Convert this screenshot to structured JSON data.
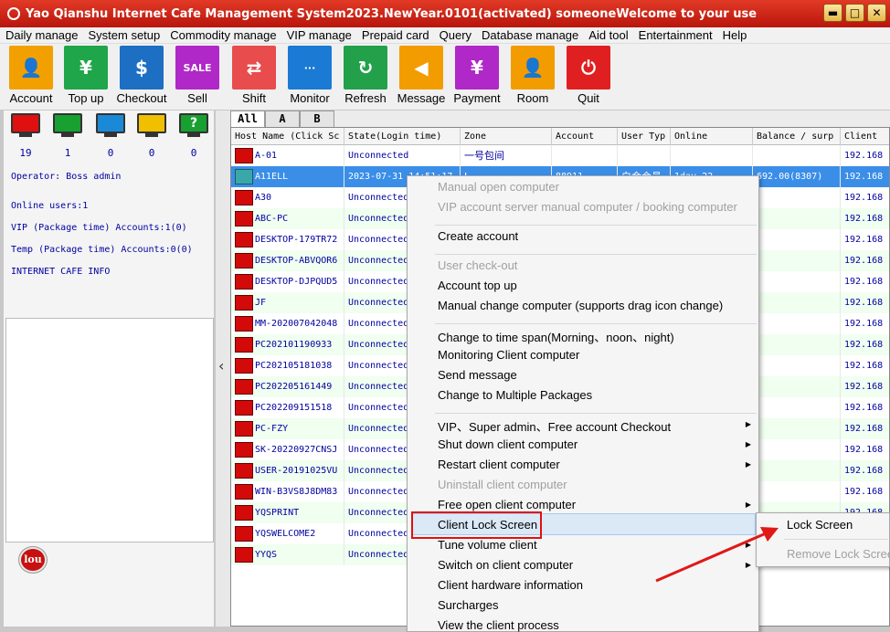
{
  "window": {
    "title": "Yao Qianshu Internet Cafe Management System2023.NewYear.0101(activated)  someoneWelcome to your use",
    "buttons": [
      "▬",
      "□",
      "✕"
    ]
  },
  "menu": [
    "Daily manage",
    "System setup",
    "Commodity manage",
    "VIP manage",
    "Prepaid card",
    "Query",
    "Database manage",
    "Aid tool",
    "Entertainment",
    "Help"
  ],
  "toolbar": [
    {
      "label": "Account",
      "color": "#f2a000",
      "icon": "person-icon",
      "glyph": "👤"
    },
    {
      "label": "Top up",
      "color": "#1fa54a",
      "icon": "money-bag-icon",
      "glyph": "¥"
    },
    {
      "label": "Checkout",
      "color": "#1d6fc4",
      "icon": "checkout-icon",
      "glyph": "$"
    },
    {
      "label": "Sell",
      "color": "#b028c8",
      "icon": "sale-tag-icon",
      "glyph": "SALE"
    },
    {
      "label": "Shift",
      "color": "#e84c4c",
      "icon": "shift-icon",
      "glyph": "⇄"
    },
    {
      "label": "Monitor",
      "color": "#1a7ad4",
      "icon": "monitor-icon",
      "glyph": "···"
    },
    {
      "label": "Refresh",
      "color": "#22a04a",
      "icon": "refresh-icon",
      "glyph": "↻"
    },
    {
      "label": "Message",
      "color": "#f29c00",
      "icon": "speaker-icon",
      "glyph": "◀"
    },
    {
      "label": "Payment",
      "color": "#b028c8",
      "icon": "payment-icon",
      "glyph": "¥"
    },
    {
      "label": "Room",
      "color": "#f29c00",
      "icon": "room-icon",
      "glyph": "👤"
    },
    {
      "label": "Quit",
      "color": "#e02020",
      "icon": "power-icon",
      "glyph": "⏻"
    }
  ],
  "status_monitors": [
    {
      "color": "#e01010",
      "count": "19"
    },
    {
      "color": "#18a030",
      "count": "1"
    },
    {
      "color": "#1a8ad8",
      "count": "0"
    },
    {
      "color": "#f0c000",
      "count": "0"
    },
    {
      "color": "#18a030",
      "count": "0",
      "glyph": "?"
    }
  ],
  "left_info": {
    "operator": "Operator: Boss admin",
    "online_users": "Online users:1",
    "vip_accounts": "VIP (Package time) Accounts:1(0)",
    "temp_accounts": "Temp (Package time) Accounts:0(0)",
    "cafe_info": "INTERNET CAFE  INFO"
  },
  "logo_text": "lou",
  "tabs": [
    "All",
    "A",
    "B"
  ],
  "columns": [
    "Host Name (Click Sc",
    "State(Login time)",
    "Zone",
    "Account",
    "User Typ",
    "Online",
    "Balance / surp",
    "Client"
  ],
  "rows": [
    {
      "host": "A-01",
      "state": "Unconnected",
      "zone": "一号包间",
      "account": "",
      "utype": "",
      "online": "",
      "balance": "",
      "client": "192.168"
    },
    {
      "host": "A11ELL",
      "state": "2023-07-31 14:51:17",
      "zone": "L",
      "account": "88911",
      "utype": "白金会员",
      "online": "1day 22",
      "balance": "692.00(8307)",
      "client": "192.168"
    },
    {
      "host": "A30",
      "state": "Unconnected",
      "zone": "",
      "account": "",
      "utype": "",
      "online": "",
      "balance": "",
      "client": "192.168"
    },
    {
      "host": "ABC-PC",
      "state": "Unconnected",
      "zone": "",
      "account": "",
      "utype": "",
      "online": "",
      "balance": "",
      "client": "192.168"
    },
    {
      "host": "DESKTOP-179TR72",
      "state": "Unconnected",
      "zone": "",
      "account": "",
      "utype": "",
      "online": "",
      "balance": "",
      "client": "192.168"
    },
    {
      "host": "DESKTOP-ABVQOR6",
      "state": "Unconnected",
      "zone": "",
      "account": "",
      "utype": "",
      "online": "",
      "balance": "",
      "client": "192.168"
    },
    {
      "host": "DESKTOP-DJPQUD5",
      "state": "Unconnected",
      "zone": "",
      "account": "",
      "utype": "",
      "online": "",
      "balance": "",
      "client": "192.168"
    },
    {
      "host": "JF",
      "state": "Unconnected",
      "zone": "",
      "account": "",
      "utype": "",
      "online": "",
      "balance": "",
      "client": "192.168"
    },
    {
      "host": "MM-202007042048",
      "state": "Unconnected",
      "zone": "",
      "account": "",
      "utype": "",
      "online": "",
      "balance": "",
      "client": "192.168"
    },
    {
      "host": "PC202101190933",
      "state": "Unconnected",
      "zone": "",
      "account": "",
      "utype": "",
      "online": "",
      "balance": "",
      "client": "192.168"
    },
    {
      "host": "PC202105181038",
      "state": "Unconnected",
      "zone": "",
      "account": "",
      "utype": "",
      "online": "",
      "balance": "",
      "client": "192.168"
    },
    {
      "host": "PC202205161449",
      "state": "Unconnected",
      "zone": "",
      "account": "",
      "utype": "",
      "online": "",
      "balance": "",
      "client": "192.168"
    },
    {
      "host": "PC202209151518",
      "state": "Unconnected",
      "zone": "",
      "account": "",
      "utype": "",
      "online": "",
      "balance": "",
      "client": "192.168"
    },
    {
      "host": "PC-FZY",
      "state": "Unconnected",
      "zone": "",
      "account": "",
      "utype": "",
      "online": "",
      "balance": "",
      "client": "192.168"
    },
    {
      "host": "SK-20220927CNSJ",
      "state": "Unconnected",
      "zone": "",
      "account": "",
      "utype": "",
      "online": "",
      "balance": "",
      "client": "192.168"
    },
    {
      "host": "USER-20191025VU",
      "state": "Unconnected",
      "zone": "",
      "account": "",
      "utype": "",
      "online": "",
      "balance": "",
      "client": "192.168"
    },
    {
      "host": "WIN-B3VS8J8DM83",
      "state": "Unconnected",
      "zone": "",
      "account": "",
      "utype": "",
      "online": "",
      "balance": "",
      "client": "192.168"
    },
    {
      "host": "YQSPRINT",
      "state": "Unconnected",
      "zone": "",
      "account": "",
      "utype": "",
      "online": "",
      "balance": "",
      "client": "192.168"
    },
    {
      "host": "YQSWELCOME2",
      "state": "Unconnected",
      "zone": "",
      "account": "",
      "utype": "",
      "online": "",
      "balance": "",
      "client": "192.168"
    },
    {
      "host": "YYQS",
      "state": "Unconnected",
      "zone": "",
      "account": "",
      "utype": "",
      "online": "",
      "balance": "",
      "client": "192.168"
    }
  ],
  "context_menu": [
    {
      "label": "Manual open computer",
      "disabled": true
    },
    {
      "label": "VIP account server manual computer / booking computer",
      "disabled": true
    },
    {
      "sep": true
    },
    {
      "label": "Create account",
      "disabled": false
    },
    {
      "sep": true
    },
    {
      "label": "User check-out",
      "disabled": true
    },
    {
      "label": "Account top up",
      "disabled": false
    },
    {
      "label": "Manual change computer (supports drag icon change)",
      "disabled": false
    },
    {
      "sep": true
    },
    {
      "label": "Change to time span(Morning、noon、night)",
      "disabled": false
    },
    {
      "label": "Monitoring Client computer",
      "disabled": false
    },
    {
      "label": "Send message",
      "disabled": false
    },
    {
      "label": "Change to Multiple Packages",
      "disabled": false
    },
    {
      "sep": true
    },
    {
      "label": "VIP、Super admin、Free account Checkout",
      "disabled": false,
      "sub": true
    },
    {
      "label": "Shut down client computer",
      "disabled": false,
      "sub": true
    },
    {
      "label": "Restart client computer",
      "disabled": false,
      "sub": true
    },
    {
      "label": "Uninstall client computer",
      "disabled": true
    },
    {
      "label": "Free open client computer",
      "disabled": false,
      "sub": true
    },
    {
      "label": "Client Lock Screen",
      "disabled": false,
      "sub": true,
      "highlighted": true
    },
    {
      "label": "Tune  volume client",
      "disabled": false,
      "sub": true
    },
    {
      "label": "Switch on client computer",
      "disabled": false,
      "sub": true
    },
    {
      "label": "Client hardware information",
      "disabled": false
    },
    {
      "label": "Surcharges",
      "disabled": false
    },
    {
      "label": "View the client process",
      "disabled": false
    }
  ],
  "submenu": [
    {
      "label": "Lock Screen",
      "disabled": false
    },
    {
      "label": "Remove Lock Screen",
      "disabled": true
    }
  ],
  "collapse_glyph": "‹"
}
